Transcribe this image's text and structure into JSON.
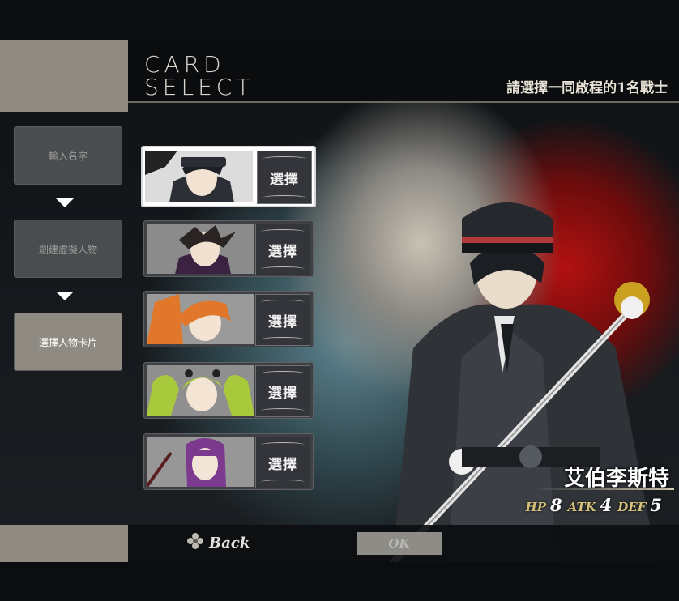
{
  "header": {
    "title_line1": "CARD",
    "title_line2": "SELECT",
    "subtitle": "請選擇一同啟程的1名戰士"
  },
  "steps": [
    {
      "label": "輸入名字",
      "active": false
    },
    {
      "label": "創建虛擬人物",
      "active": false
    },
    {
      "label": "選擇人物卡片",
      "active": true
    }
  ],
  "cards": [
    {
      "choose_label": "選擇",
      "selected": true,
      "hair": "#1c1f24"
    },
    {
      "choose_label": "選擇",
      "selected": false,
      "hair": "#2a2523"
    },
    {
      "choose_label": "選擇",
      "selected": false,
      "hair": "#e0772a"
    },
    {
      "choose_label": "選擇",
      "selected": false,
      "hair": "#a8c93b"
    },
    {
      "choose_label": "選擇",
      "selected": false,
      "hair": "#7b3a8e"
    }
  ],
  "character": {
    "name": "艾伯李斯特",
    "hp_label": "HP",
    "hp": "8",
    "atk_label": "ATK",
    "atk": "4",
    "def_label": "DEF",
    "def": "5"
  },
  "footer": {
    "back_label": "Back",
    "ok_label": "OK"
  },
  "icons": {
    "back": "flower-icon"
  }
}
